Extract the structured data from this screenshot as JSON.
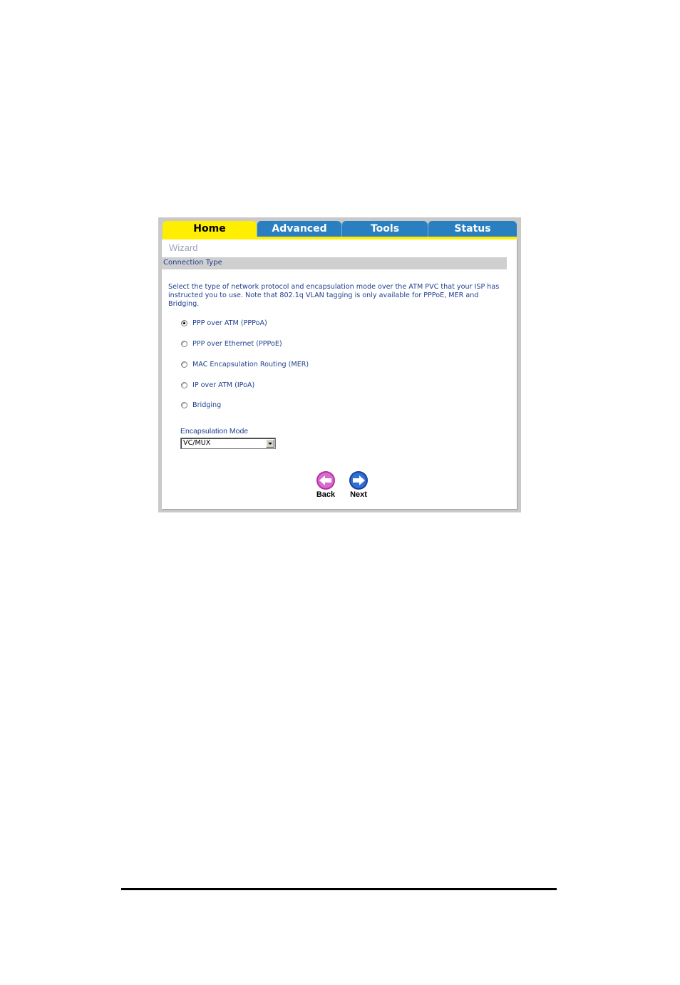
{
  "tabs": {
    "home": "Home",
    "advanced": "Advanced",
    "tools": "Tools",
    "status": "Status"
  },
  "wizard": {
    "title": "Wizard",
    "section": "Connection Type",
    "description": "Select the type of network protocol and encapsulation mode over the ATM PVC that your ISP has instructed you to use. Note that 802.1q VLAN tagging is only available for PPPoE, MER and Bridging."
  },
  "options": [
    {
      "label": "PPP over ATM (PPPoA)",
      "selected": true
    },
    {
      "label": "PPP over Ethernet (PPPoE)",
      "selected": false
    },
    {
      "label": "MAC Encapsulation Routing (MER)",
      "selected": false
    },
    {
      "label": "IP over ATM (IPoA)",
      "selected": false
    },
    {
      "label": "Bridging",
      "selected": false
    }
  ],
  "encapsulation": {
    "label": "Encapsulation Mode",
    "value": "VC/MUX"
  },
  "buttons": {
    "back": "Back",
    "next": "Next"
  },
  "colors": {
    "home_tab": "#ffee00",
    "tab_blue": "#2a7fc0",
    "text_blue": "#1f3f8f",
    "back_icon": "#cc55cc",
    "next_icon": "#2255cc"
  }
}
